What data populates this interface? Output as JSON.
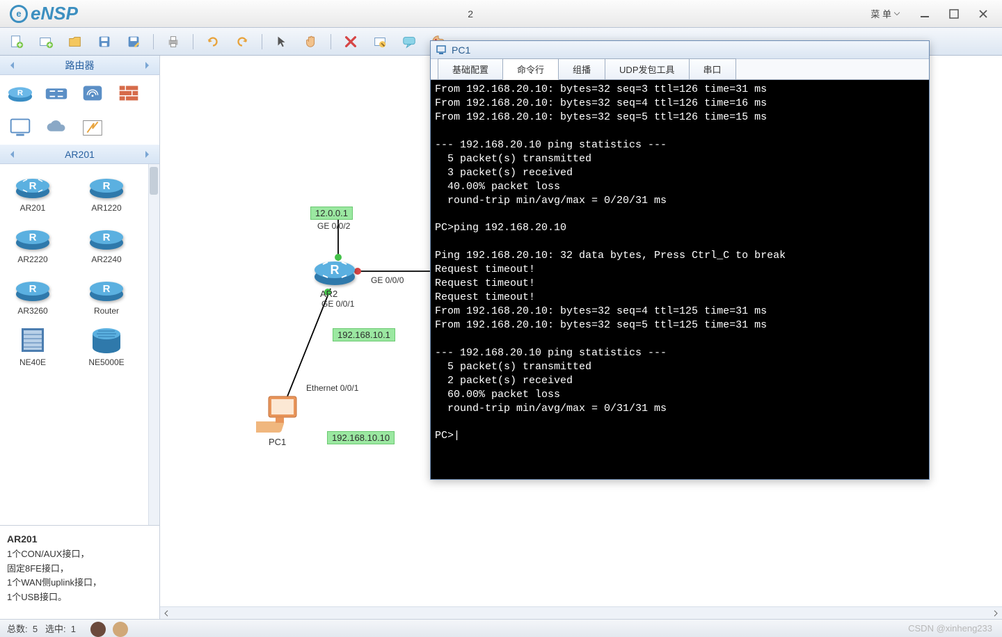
{
  "app": {
    "name": "eNSP",
    "doc_title": "2",
    "menu_label": "菜 单"
  },
  "sidebar": {
    "category_title": "路由器",
    "model_header": "AR201",
    "devices": [
      {
        "label": "AR201"
      },
      {
        "label": "AR1220"
      },
      {
        "label": "AR2220"
      },
      {
        "label": "AR2240"
      },
      {
        "label": "AR3260"
      },
      {
        "label": "Router"
      },
      {
        "label": "NE40E"
      },
      {
        "label": "NE5000E"
      }
    ],
    "info_title": "AR201",
    "info_lines": [
      "1个CON/AUX接口，",
      "固定8FE接口，",
      "1个WAN侧uplink接口，",
      "1个USB接口。"
    ]
  },
  "canvas": {
    "ip1": "12.0.0.1",
    "ge002": "GE 0/0/2",
    "ge000": "GE 0/0/0",
    "ge001": "GE 0/0/1",
    "ar2_label": "AR2",
    "ip2": "192.168.10.1",
    "eth": "Ethernet 0/0/1",
    "ip3": "192.168.10.10",
    "pc1_label": "PC1"
  },
  "pc": {
    "title": "PC1",
    "tabs": [
      "基础配置",
      "命令行",
      "组播",
      "UDP发包工具",
      "串口"
    ],
    "terminal": "From 192.168.20.10: bytes=32 seq=3 ttl=126 time=31 ms\nFrom 192.168.20.10: bytes=32 seq=4 ttl=126 time=16 ms\nFrom 192.168.20.10: bytes=32 seq=5 ttl=126 time=15 ms\n\n--- 192.168.20.10 ping statistics ---\n  5 packet(s) transmitted\n  3 packet(s) received\n  40.00% packet loss\n  round-trip min/avg/max = 0/20/31 ms\n\nPC>ping 192.168.20.10\n\nPing 192.168.20.10: 32 data bytes, Press Ctrl_C to break\nRequest timeout!\nRequest timeout!\nRequest timeout!\nFrom 192.168.20.10: bytes=32 seq=4 ttl=125 time=31 ms\nFrom 192.168.20.10: bytes=32 seq=5 ttl=125 time=31 ms\n\n--- 192.168.20.10 ping statistics ---\n  5 packet(s) transmitted\n  2 packet(s) received\n  60.00% packet loss\n  round-trip min/avg/max = 0/31/31 ms\n\nPC>|"
  },
  "status": {
    "total_label": "总数:",
    "total": "5",
    "sel_label": "选中:",
    "sel": "1",
    "watermark": "CSDN @xinheng233"
  }
}
